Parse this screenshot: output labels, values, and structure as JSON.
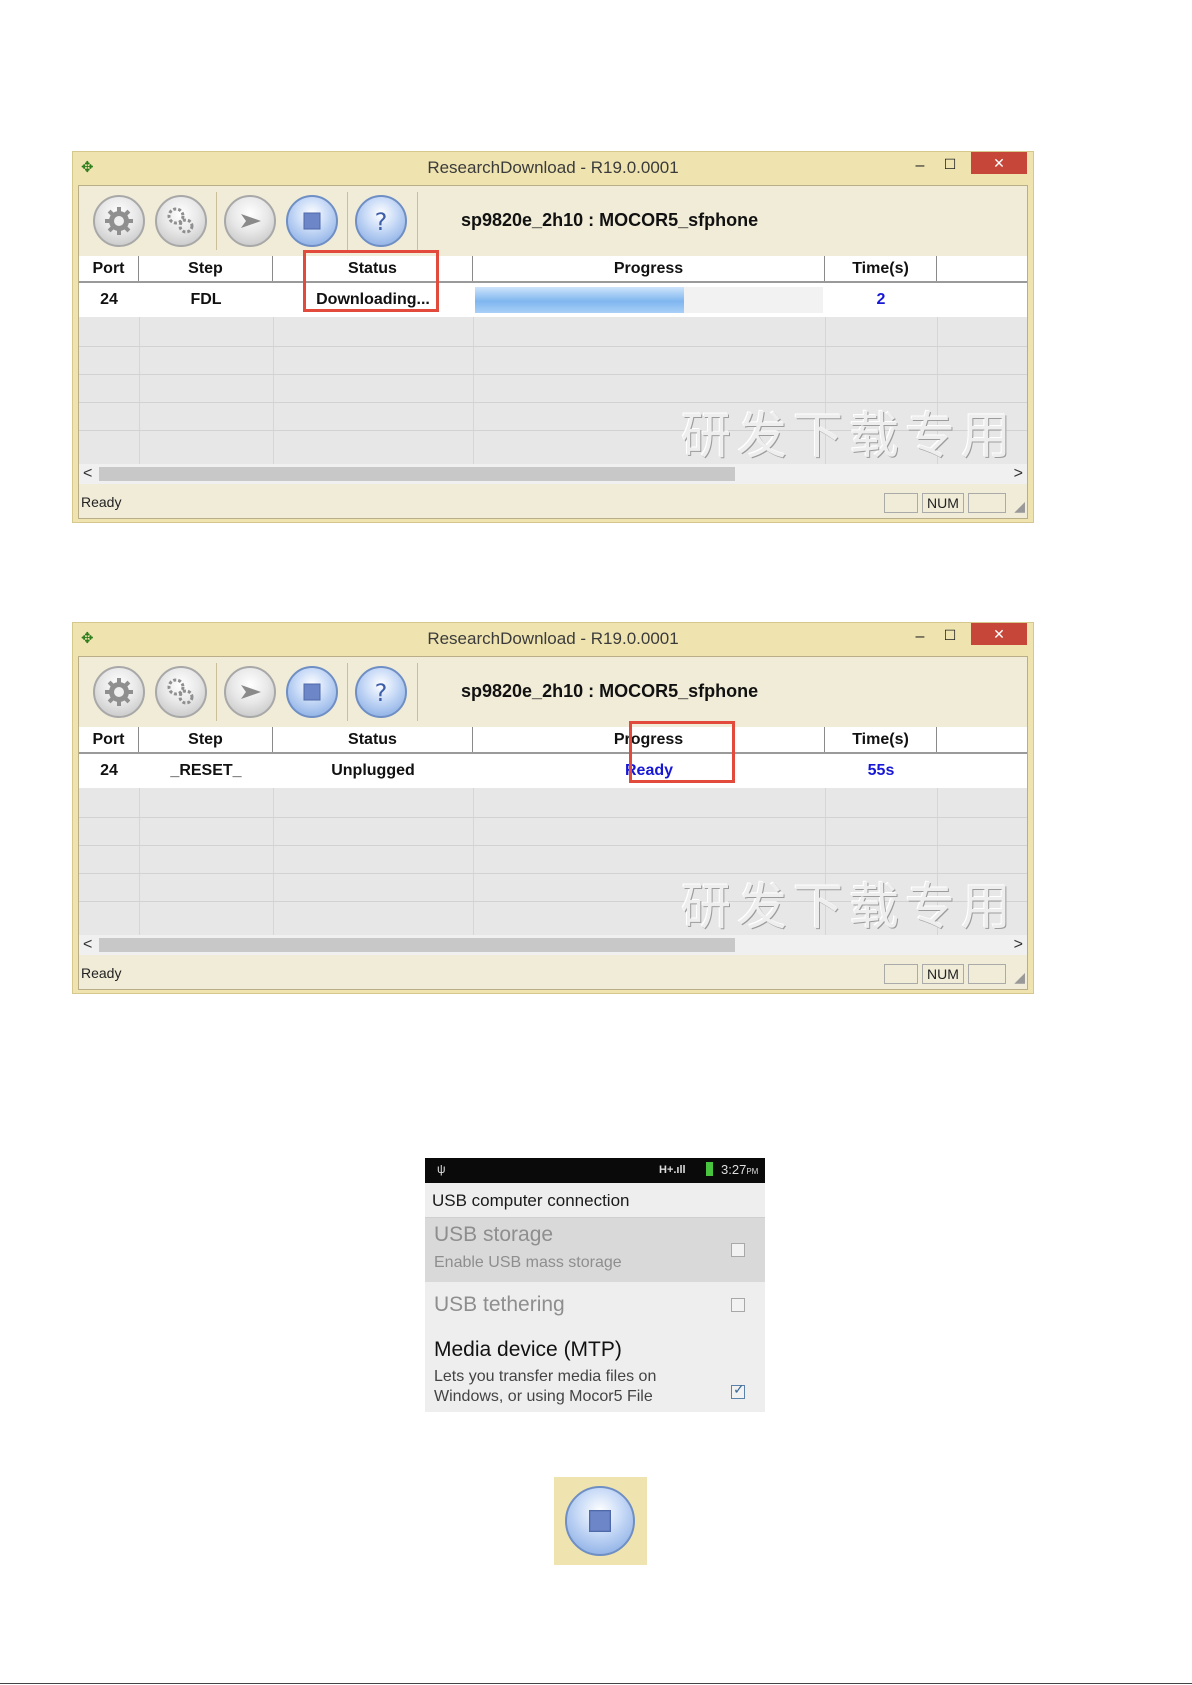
{
  "windows": [
    {
      "title": "ResearchDownload - R19.0.0001",
      "project": "sp9820e_2h10 : MOCOR5_sfphone",
      "columns": [
        "Port",
        "Step",
        "Status",
        "Progress",
        "Time(s)"
      ],
      "row": {
        "port": "24",
        "step": "FDL",
        "status": "Downloading...",
        "progress": "",
        "time": "2"
      },
      "progress_fraction": 0.6,
      "watermark": "研发下载专用",
      "status_text": "Ready",
      "num_indicator": "NUM"
    },
    {
      "title": "ResearchDownload - R19.0.0001",
      "project": "sp9820e_2h10 : MOCOR5_sfphone",
      "columns": [
        "Port",
        "Step",
        "Status",
        "Progress",
        "Time(s)"
      ],
      "row": {
        "port": "24",
        "step": "_RESET_",
        "status": "Unplugged",
        "progress": "Ready",
        "time": "55s"
      },
      "progress_fraction": 0,
      "watermark": "研发下载专用",
      "status_text": "Ready",
      "num_indicator": "NUM"
    }
  ],
  "phone": {
    "status_bar": {
      "signal": "H+",
      "time": "3:27",
      "ampm": "PM"
    },
    "title": "USB computer connection",
    "options": [
      {
        "label": "USB storage",
        "sub": "Enable USB mass storage",
        "checked": false
      },
      {
        "label": "USB tethering",
        "sub": "",
        "checked": false
      },
      {
        "label": "Media device (MTP)",
        "sub_line1": "Lets you transfer media files on",
        "sub_line2": "Windows, or using Mocor5 File",
        "checked": true
      }
    ]
  },
  "icons": {
    "app": "research-download-app-icon",
    "settings": "gear-icon",
    "advanced_settings": "gears-icon",
    "start": "play-arrow-icon",
    "stop": "stop-square-icon",
    "help": "help-question-icon"
  },
  "colors": {
    "window_frame": "#efe4b0",
    "highlight": "#e24a3b",
    "value_text": "#1717d6",
    "progress_fill": "#7fb6ef"
  }
}
